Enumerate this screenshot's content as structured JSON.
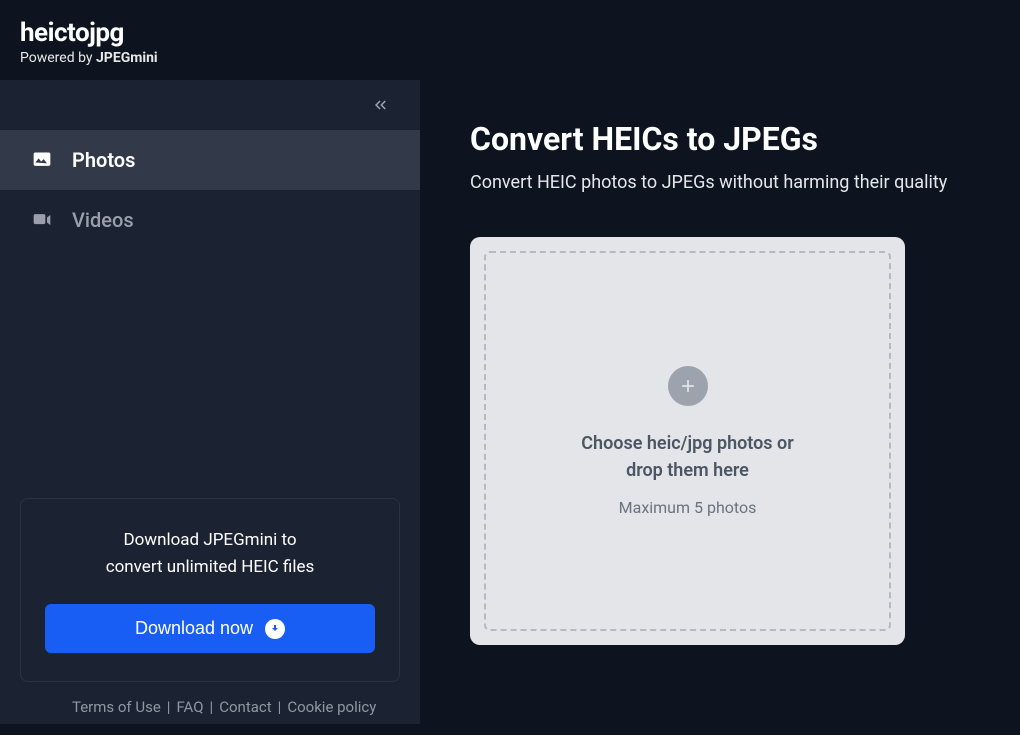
{
  "header": {
    "logo": "heictojpg",
    "powered_by_prefix": "Powered by ",
    "powered_by_brand": "JPEGmini"
  },
  "sidebar": {
    "items": [
      {
        "label": "Photos",
        "icon": "photo-icon",
        "active": true
      },
      {
        "label": "Videos",
        "icon": "video-icon",
        "active": false
      }
    ],
    "promo": {
      "text_line1": "Download JPEGmini to",
      "text_line2": "convert unlimited HEIC files",
      "button_label": "Download now"
    },
    "footer_links": [
      "Terms of Use",
      "FAQ",
      "Contact",
      "Cookie policy"
    ]
  },
  "main": {
    "title": "Convert HEICs to JPEGs",
    "subtitle": "Convert HEIC photos to JPEGs without harming their quality",
    "dropzone": {
      "line1": "Choose heic/jpg photos or",
      "line2": "drop them here",
      "limit": "Maximum 5 photos"
    }
  }
}
